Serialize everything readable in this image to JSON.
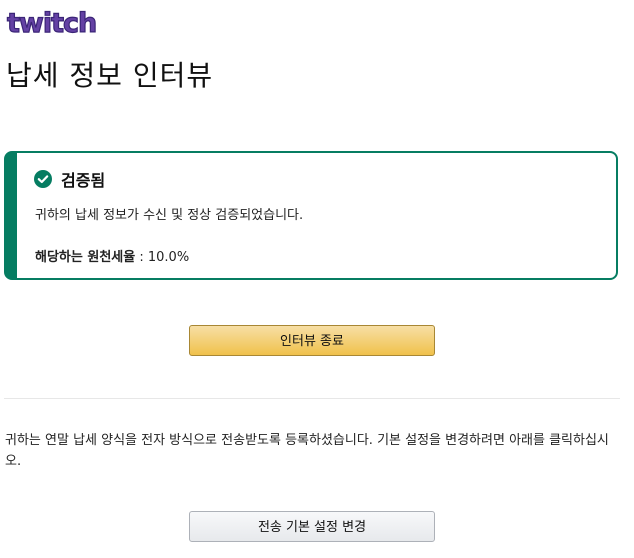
{
  "brand": {
    "logo_text": "twitch",
    "color": "#6441a4"
  },
  "page": {
    "title": "납세 정보 인터뷰"
  },
  "status": {
    "icon": "check-circle-icon",
    "color": "#067d62",
    "title": "검증됨",
    "message": "귀하의 납세 정보가 수신 및 정상 검증되었습니다.",
    "rate_label": "해당하는 원천세율",
    "rate_separator": " : ",
    "rate_value": "10.0%"
  },
  "actions": {
    "end_interview_label": "인터뷰 종료",
    "change_delivery_label": "전송 기본 설정 변경"
  },
  "info": {
    "text": "귀하는 연말 납세 양식을 전자 방식으로 전송받도록 등록하셨습니다. 기본 설정을 변경하려면 아래를 클릭하십시오."
  }
}
